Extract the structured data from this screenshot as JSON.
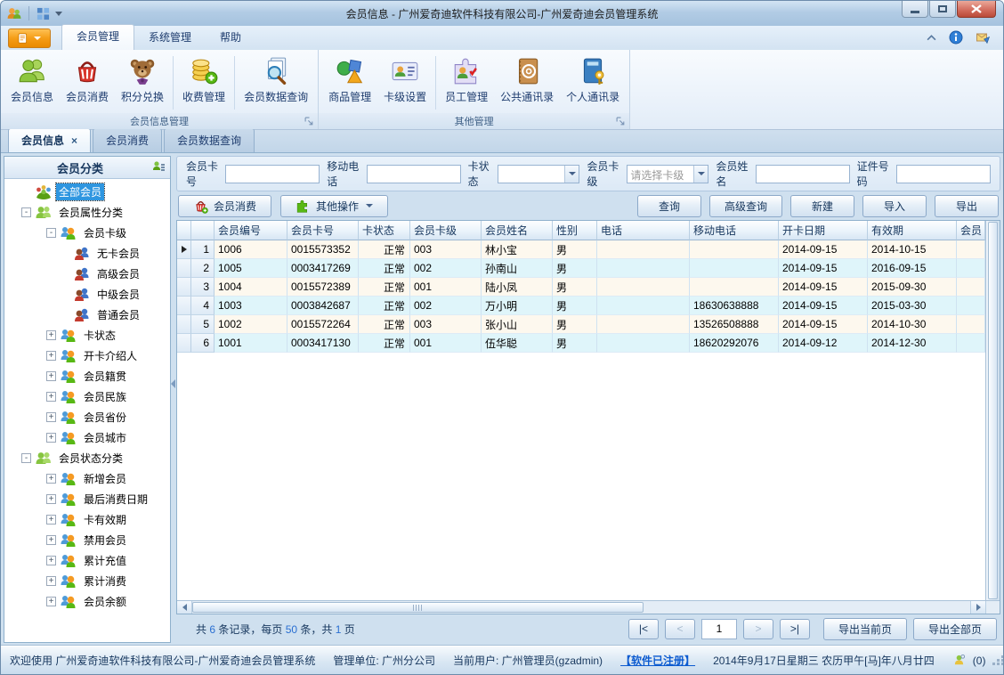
{
  "window": {
    "title": "会员信息 - 广州爱奇迪软件科技有限公司-广州爱奇迪会员管理系统"
  },
  "colors": {
    "accent_orange": "#f59d17",
    "selection_blue": "#2f96e0",
    "row_odd": "#fdf8ee",
    "row_even": "#dff5fa",
    "title_gradient": "#b2cce5"
  },
  "ribbon": {
    "tabs": [
      {
        "label": "会员管理",
        "active": true
      },
      {
        "label": "系统管理",
        "active": false
      },
      {
        "label": "帮助",
        "active": false
      }
    ],
    "groups": [
      {
        "label": "会员信息管理",
        "buttons": [
          {
            "label": "会员信息",
            "icon": "members-icon"
          },
          {
            "label": "会员消费",
            "icon": "basket-icon"
          },
          {
            "label": "积分兑换",
            "icon": "teddy-bear-icon"
          },
          {
            "label": "收费管理",
            "icon": "coins-add-icon"
          },
          {
            "label": "会员数据查询",
            "icon": "document-search-icon"
          }
        ]
      },
      {
        "label": "其他管理",
        "buttons": [
          {
            "label": "商品管理",
            "icon": "goods-shapes-icon"
          },
          {
            "label": "卡级设置",
            "icon": "id-card-icon"
          },
          {
            "label": "员工管理",
            "icon": "staff-puzzle-icon"
          },
          {
            "label": "公共通讯录",
            "icon": "public-addressbook-icon"
          },
          {
            "label": "个人通讯录",
            "icon": "personal-addressbook-icon"
          }
        ]
      }
    ]
  },
  "doc_tabs": {
    "close": "×",
    "items": [
      {
        "label": "会员信息",
        "active": true
      },
      {
        "label": "会员消费",
        "active": false
      },
      {
        "label": "会员数据查询",
        "active": false
      }
    ]
  },
  "sidebar": {
    "title": "会员分类",
    "tree": [
      {
        "label": "全部会员",
        "icon": "group"
      },
      {
        "label": "会员属性分类",
        "expand": "-",
        "icon": "people-green"
      },
      {
        "label": "会员卡级",
        "expand": "-",
        "icon": "pair"
      },
      {
        "label": "无卡会员",
        "icon": "pair-red"
      },
      {
        "label": "高级会员",
        "icon": "pair-red"
      },
      {
        "label": "中级会员",
        "icon": "pair-red"
      },
      {
        "label": "普通会员",
        "icon": "pair-red"
      },
      {
        "label": "卡状态",
        "expand": "+",
        "icon": "pair"
      },
      {
        "label": "开卡介绍人",
        "expand": "+",
        "icon": "pair"
      },
      {
        "label": "会员籍贯",
        "expand": "+",
        "icon": "pair"
      },
      {
        "label": "会员民族",
        "expand": "+",
        "icon": "pair"
      },
      {
        "label": "会员省份",
        "expand": "+",
        "icon": "pair"
      },
      {
        "label": "会员城市",
        "expand": "+",
        "icon": "pair"
      },
      {
        "label": "会员状态分类",
        "expand": "-",
        "icon": "people-green"
      },
      {
        "label": "新增会员",
        "expand": "+",
        "icon": "pair"
      },
      {
        "label": "最后消费日期",
        "expand": "+",
        "icon": "pair"
      },
      {
        "label": "卡有效期",
        "expand": "+",
        "icon": "pair"
      },
      {
        "label": "禁用会员",
        "expand": "+",
        "icon": "pair"
      },
      {
        "label": "累计充值",
        "expand": "+",
        "icon": "pair"
      },
      {
        "label": "累计消费",
        "expand": "+",
        "icon": "pair"
      },
      {
        "label": "会员余额",
        "expand": "+",
        "icon": "pair"
      }
    ]
  },
  "search": {
    "fields": [
      {
        "label": "会员卡号",
        "value": ""
      },
      {
        "label": "移动电话",
        "value": ""
      },
      {
        "label": "卡状态",
        "value": ""
      },
      {
        "label": "会员卡级",
        "placeholder": "请选择卡级"
      },
      {
        "label": "会员姓名",
        "value": ""
      },
      {
        "label": "证件号码",
        "value": ""
      }
    ]
  },
  "toolbar": {
    "member_consume": "会员消费",
    "other_ops": "其他操作",
    "query": "查询",
    "adv_query": "高级查询",
    "new": "新建",
    "import": "导入",
    "export": "导出"
  },
  "table": {
    "columns": [
      "会员编号",
      "会员卡号",
      "卡状态",
      "会员卡级",
      "会员姓名",
      "性别",
      "电话",
      "移动电话",
      "开卡日期",
      "有效期",
      "会员"
    ],
    "rows": [
      {
        "num": "1",
        "id": "1006",
        "card": "0015573352",
        "status": "正常",
        "level": "003",
        "name": "林小宝",
        "gender": "男",
        "phone": "",
        "mobile": "",
        "open": "2014-09-15",
        "valid": "2014-10-15"
      },
      {
        "num": "2",
        "id": "1005",
        "card": "0003417269",
        "status": "正常",
        "level": "002",
        "name": "孙南山",
        "gender": "男",
        "phone": "",
        "mobile": "",
        "open": "2014-09-15",
        "valid": "2016-09-15"
      },
      {
        "num": "3",
        "id": "1004",
        "card": "0015572389",
        "status": "正常",
        "level": "001",
        "name": "陆小凤",
        "gender": "男",
        "phone": "",
        "mobile": "",
        "open": "2014-09-15",
        "valid": "2015-09-30"
      },
      {
        "num": "4",
        "id": "1003",
        "card": "0003842687",
        "status": "正常",
        "level": "002",
        "name": "万小明",
        "gender": "男",
        "phone": "",
        "mobile": "18630638888",
        "open": "2014-09-15",
        "valid": "2015-03-30"
      },
      {
        "num": "5",
        "id": "1002",
        "card": "0015572264",
        "status": "正常",
        "level": "003",
        "name": "张小山",
        "gender": "男",
        "phone": "",
        "mobile": "13526508888",
        "open": "2014-09-15",
        "valid": "2014-10-30"
      },
      {
        "num": "6",
        "id": "1001",
        "card": "0003417130",
        "status": "正常",
        "level": "001",
        "name": "伍华聪",
        "gender": "男",
        "phone": "",
        "mobile": "18620292076",
        "open": "2014-09-12",
        "valid": "2014-12-30"
      }
    ]
  },
  "pager": {
    "summary_parts": [
      "共 ",
      "6",
      " 条记录，每页 ",
      "50",
      " 条，共 ",
      "1",
      " 页"
    ],
    "first": "|<",
    "prev": "<",
    "page": "1",
    "next": ">",
    "last": ">|",
    "export_current": "导出当前页",
    "export_all": "导出全部页"
  },
  "statusbar": {
    "welcome": "欢迎使用 广州爱奇迪软件科技有限公司-广州爱奇迪会员管理系统",
    "unit": "管理单位: 广州分公司",
    "user": "当前用户: 广州管理员(gzadmin)",
    "registered": "【软件已注册】",
    "datetime": "2014年9月17日星期三 农历甲午[马]年八月廿四",
    "online_count": "(0)"
  }
}
